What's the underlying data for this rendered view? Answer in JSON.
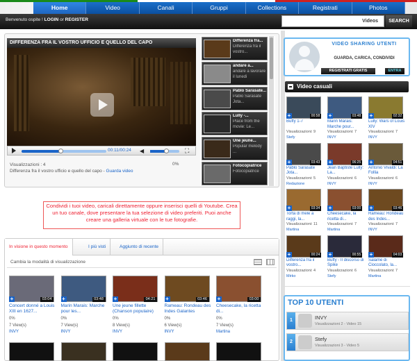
{
  "nav": {
    "tabs": [
      "Home",
      "Video",
      "Canali",
      "Gruppi",
      "Collections",
      "Registrati",
      "Photos"
    ]
  },
  "header": {
    "welcome": "Benvenuto ospite !",
    "login": "LOGIN",
    "or": "or",
    "register": "REGISTER",
    "search_scope": "Videos",
    "search_button": "SEARCH"
  },
  "player": {
    "title": "DIFFERENZA FRA IL VOSTRO UFFICIO E QUELLO DEL CAPO",
    "time": "00:11/00:24",
    "progress": 0.46,
    "volume": 0.55,
    "views": "Visualizzazioni : 4",
    "desc": "Differenza fra il vostro ufficio e quello del capo - ",
    "watch": "Guarda video",
    "percent": "0%"
  },
  "playlist": [
    {
      "title": "Differenza fra...",
      "desc": "Differenza fra il vostro..."
    },
    {
      "title": "andare a...",
      "desc": "andare a lavorare il lunedi"
    },
    {
      "title": "Pablo Sarasate...",
      "desc": "Pablo Sarasate Jota..."
    },
    {
      "title": "Lully -...",
      "desc": "Place from the movie: Le..."
    },
    {
      "title": "Une jeune...",
      "desc": "Popular melody ..."
    },
    {
      "title": "Fotocopiatrice",
      "desc": "Fotocopiatrice"
    }
  ],
  "promo": "Condividi i tuoi video, caricali direttamente oppure inserisci quelli di Youtube. Crea un tuo canale, dove presentare la tua selezione di video preferiti. Puoi anche creare una galleria virtuale con le tue fotografie.",
  "tabs": [
    "In visione in questo momento",
    "I più visti",
    "Aggiunto di recente"
  ],
  "mode_label": "Cambia la modalità di visualizzazione",
  "videos": [
    {
      "title": "Concert donné a Louis XIII en 1627...",
      "duration": "03:04",
      "pct": "0%",
      "views": "7 View(s)",
      "user": "INVY",
      "color": "#6a6a78"
    },
    {
      "title": "Marin Marais: Marche pour les...",
      "duration": "03:48",
      "pct": "0%",
      "views": "7 View(s)",
      "user": "INVY",
      "color": "#3e5a80"
    },
    {
      "title": "Une jeune fillette (Chanson populaire)",
      "duration": "04:21",
      "pct": "0%",
      "views": "8 View(s)",
      "user": "INVY",
      "color": "#7a2e1a"
    },
    {
      "title": "Rameau: Rondeau des Indes Galantes",
      "duration": "03:46",
      "pct": "0%",
      "views": "6 View(s)",
      "user": "INVY",
      "color": "#6e4a20"
    },
    {
      "title": "Cheesecake, la ricetta di...",
      "duration": "03:00",
      "pct": "0%",
      "views": "7 View(s)",
      "user": "Martina",
      "color": "#8a5030"
    }
  ],
  "register_box": {
    "title": "VIDEO SHARING UTENTI",
    "subtitle": "GUARDA, CARICA, CONDIVIDI",
    "button": "REGISTRATI GRATIS",
    "enter": "ENTRA"
  },
  "random": {
    "heading": "Video casuali",
    "items": [
      {
        "title": "Buffy 1-7",
        "duration": "00:58",
        "views": "Visualizzazioni: 9",
        "user": "Stefy",
        "color": "#3a4a5a"
      },
      {
        "title": "Marin Marais: Marche pour...",
        "duration": "03:48",
        "views": "Visualizzazioni: 7",
        "user": "INVY",
        "color": "#3e5a80"
      },
      {
        "title": "Lully: Wars of Louis XIV",
        "duration": "02:32",
        "views": "Visualizzazioni: 7",
        "user": "INVY",
        "color": "#8a7a30"
      },
      {
        "title": "Pablo Sarasate Jota...",
        "duration": "03:43",
        "views": "Visualizzazioni: 5",
        "user": "Redazione",
        "color": "#4a4a4a"
      },
      {
        "title": "Jean Baptiste Lully: La...",
        "duration": "06:25",
        "views": "Visualizzazioni: 6",
        "user": "INVY",
        "color": "#7a3a2a"
      },
      {
        "title": "Antonio Vivaldi: La Follia",
        "duration": "04:51",
        "views": "Visualizzazioni: 6",
        "user": "INVY",
        "color": "#6a5a3a"
      },
      {
        "title": "Torta di mele a raggi, la...",
        "duration": "03:34",
        "views": "Visualizzazioni: 11",
        "user": "Martina",
        "color": "#9a6a30"
      },
      {
        "title": "Cheesecake, la ricetta di...",
        "duration": "03:00",
        "views": "Visualizzazioni: 7",
        "user": "Martina",
        "color": "#8a5030"
      },
      {
        "title": "Rameau: Rondeau des Indes...",
        "duration": "03:46",
        "views": "Visualizzazioni: 7",
        "user": "INVY",
        "color": "#6e4a20"
      },
      {
        "title": "Differenza fra il vostro...",
        "duration": "00:24",
        "views": "Visualizzazioni: 4",
        "user": "Mirko",
        "color": "#5a3a1a"
      },
      {
        "title": "Buffy - Il discorso di Spike",
        "duration": "00:55",
        "views": "Visualizzazioni: 6",
        "user": "Stefy",
        "color": "#2a2a3a"
      },
      {
        "title": "Salame di Cioccolato, la...",
        "duration": "04:03",
        "views": "Visualizzazioni: 7",
        "user": "Martina",
        "color": "#5a2a1a"
      }
    ]
  },
  "top_users": {
    "title": "TOP 10 UTENTI",
    "items": [
      {
        "rank": "1",
        "name": "INVY",
        "stats": "Visualizzazioni  2 - Video  15"
      },
      {
        "rank": "2",
        "name": "Stefy",
        "stats": "Visualizzazioni  3 - Video  5"
      }
    ]
  }
}
